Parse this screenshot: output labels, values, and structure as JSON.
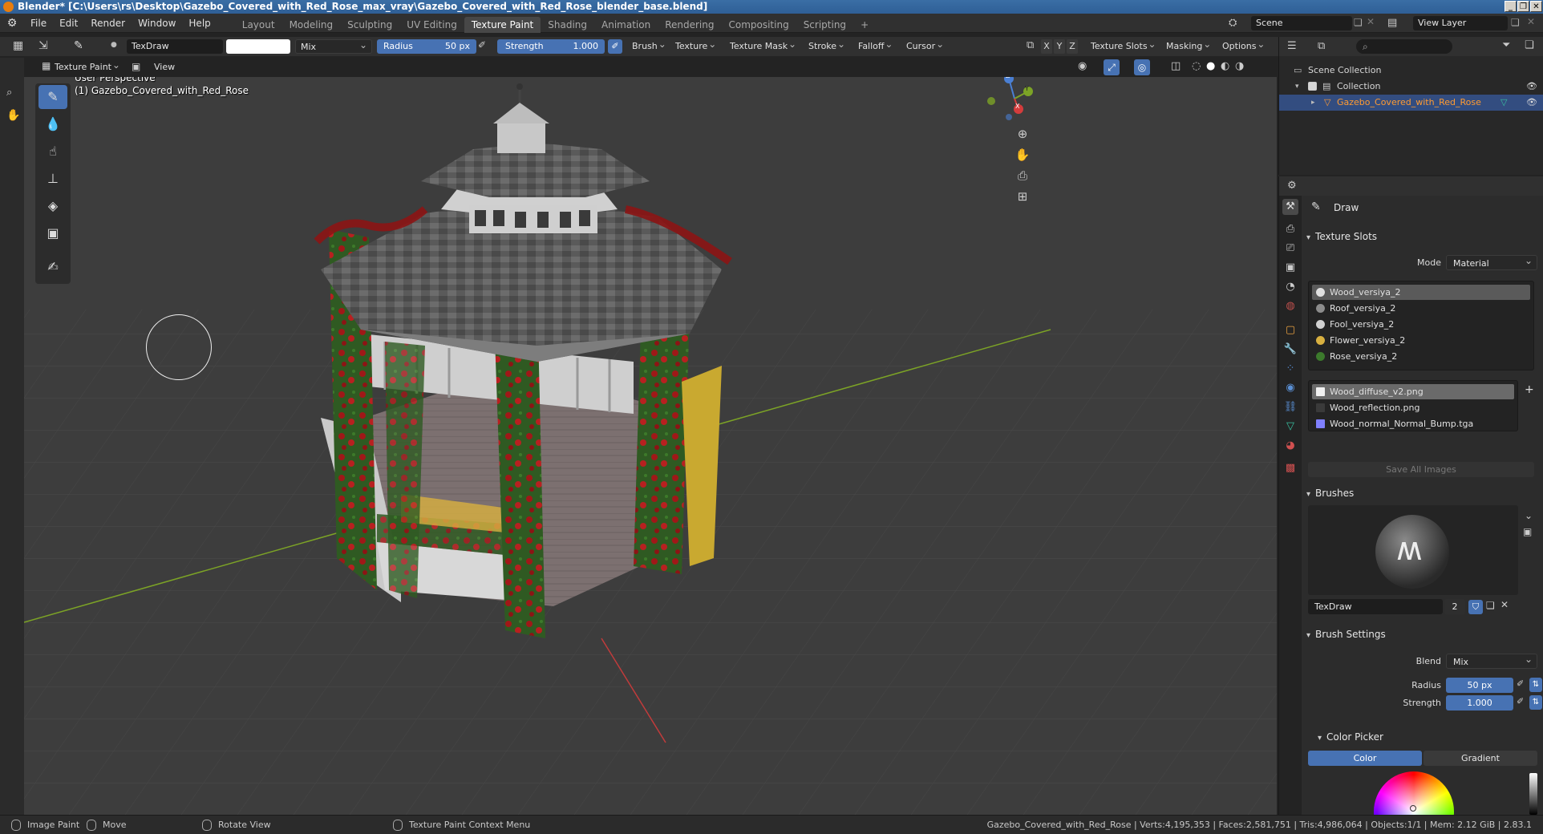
{
  "titlebar": {
    "title": "Blender* [C:\\Users\\rs\\Desktop\\Gazebo_Covered_with_Red_Rose_max_vray\\Gazebo_Covered_with_Red_Rose_blender_base.blend]",
    "minimize": "_",
    "maximize": "❐",
    "close": "✕"
  },
  "menubar": {
    "items": [
      "File",
      "Edit",
      "Render",
      "Window",
      "Help"
    ],
    "workspaces": [
      "Layout",
      "Modeling",
      "Sculpting",
      "UV Editing",
      "Texture Paint",
      "Shading",
      "Animation",
      "Rendering",
      "Compositing",
      "Scripting"
    ],
    "active_workspace": "Texture Paint",
    "add_workspace": "+",
    "scene": "Scene",
    "view_layer": "View Layer"
  },
  "toolheader": {
    "brush_name": "TexDraw",
    "blend_mode": "Mix",
    "radius_label": "Radius",
    "radius_value": "50 px",
    "strength_label": "Strength",
    "strength_value": "1.000",
    "menus": [
      "Brush",
      "Texture",
      "Texture Mask",
      "Stroke",
      "Falloff",
      "Cursor"
    ],
    "axes": [
      "X",
      "Y",
      "Z"
    ],
    "right_menus": [
      "Texture Slots",
      "Masking",
      "Options"
    ],
    "mode": "Texture Paint",
    "view": "View"
  },
  "viewport": {
    "perspective": "User Perspective",
    "object_label": "(1) Gazebo_Covered_with_Red_Rose",
    "gizmo_labels": [
      "Z",
      "Y",
      "X"
    ]
  },
  "outliner": {
    "scene_collection": "Scene Collection",
    "collection": "Collection",
    "object": "Gazebo_Covered_with_Red_Rose"
  },
  "properties": {
    "tool_name": "Draw",
    "texture_slots_header": "Texture Slots",
    "mode_label": "Mode",
    "mode_value": "Material",
    "materials": [
      {
        "name": "Wood_versiya_2",
        "color": "#e0e0e0"
      },
      {
        "name": "Roof_versiya_2",
        "color": "#8c8c8c"
      },
      {
        "name": "Fool_versiya_2",
        "color": "#d0d0d0"
      },
      {
        "name": "Flower_versiya_2",
        "color": "#d8b040"
      },
      {
        "name": "Rose_versiya_2",
        "color": "#3c7a2c"
      }
    ],
    "images": [
      {
        "name": "Wood_diffuse_v2.png",
        "color": "#f0f0f0"
      },
      {
        "name": "Wood_reflection.png",
        "color": "#3a3a3a"
      },
      {
        "name": "Wood_normal_Normal_Bump.tga",
        "color": "#8080ff"
      }
    ],
    "save_all": "Save All Images",
    "brushes_header": "Brushes",
    "brush_name": "TexDraw",
    "brush_users": "2",
    "brush_settings_header": "Brush Settings",
    "blend_label": "Blend",
    "blend_value": "Mix",
    "radius_label": "Radius",
    "radius_value": "50 px",
    "strength_label": "Strength",
    "strength_value": "1.000",
    "color_picker_header": "Color Picker",
    "color_tab": "Color",
    "gradient_tab": "Gradient"
  },
  "statusbar": {
    "image_paint": "Image Paint",
    "move": "Move",
    "rotate_view": "Rotate View",
    "context_menu": "Texture Paint Context Menu",
    "stats": "Gazebo_Covered_with_Red_Rose | Verts:4,195,353 | Faces:2,581,751 | Tris:4,986,064 | Objects:1/1 | Mem: 2.12 GiB | 2.83.1"
  },
  "colors": {
    "accent": "#4772b3",
    "selection": "#334d80",
    "active_object": "#ff9b32"
  }
}
